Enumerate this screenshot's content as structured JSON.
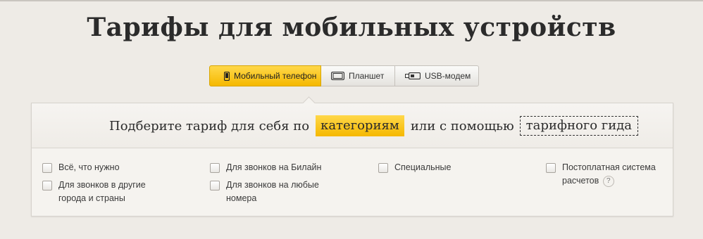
{
  "page": {
    "title": "Тарифы для мобильных устройств"
  },
  "device_tabs": [
    {
      "label": "Мобильный телефон",
      "icon": "mobile-phone-icon",
      "active": true
    },
    {
      "label": "Планшет",
      "icon": "tablet-icon",
      "active": false
    },
    {
      "label": "USB-модем",
      "icon": "usb-modem-icon",
      "active": false
    }
  ],
  "selector": {
    "prefix": "Подберите тариф для себя по",
    "category_button": "категориям",
    "middle": "или с помощью",
    "guide_button": "тарифного гида"
  },
  "options": [
    {
      "label": "Всё, что нужно",
      "checked": false
    },
    {
      "label": "Для звонков в другие города и страны",
      "checked": false
    },
    {
      "label": "Для звонков на Билайн",
      "checked": false
    },
    {
      "label": "Для звонков на любые номера",
      "checked": false
    },
    {
      "label": "Специальные",
      "checked": false
    },
    {
      "label": "Постоплатная система расчетов",
      "checked": false,
      "help": "?"
    }
  ],
  "colors": {
    "accent": "#f5b800",
    "accent_light": "#ffd84a",
    "background": "#eeebe6"
  }
}
